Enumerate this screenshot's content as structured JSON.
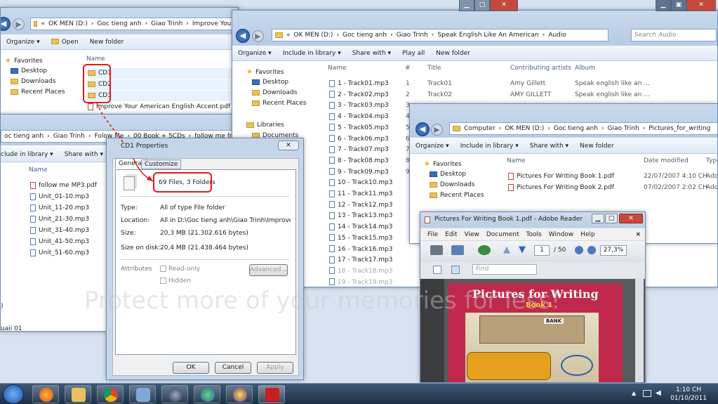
{
  "colors": {
    "annotation": "#e21b1b",
    "selection": "#cfe3fc"
  },
  "win1": {
    "address": [
      "«",
      "OK MEN (D:)",
      "›",
      "Goc tieng anh",
      "›",
      "Giao Trinh",
      "›",
      "Improve Your"
    ],
    "toolbar": {
      "organize": "Organize ▾",
      "open": "Open",
      "new_folder": "New folder"
    },
    "nav": [
      "Favorites",
      "Desktop",
      "Downloads",
      "Recent Places"
    ],
    "col_name": "Name",
    "items": [
      "CD1",
      "CD2",
      "CD3",
      "Improve Your American English Accent.pdf"
    ]
  },
  "win1b": {
    "address": [
      "oc tieng anh",
      "›",
      "Giao Trinh",
      "›",
      "Folow Me",
      "›",
      "00 Book + 5CDs",
      "›",
      "follow me from N"
    ],
    "toolbar": {
      "include": "clude in library ▾",
      "share": "Share with ▾"
    },
    "col_name": "Name",
    "items": [
      "follow me MP3.pdf",
      "Unit_01-10.mp3",
      "Unit_11-20.mp3",
      "Unit_21-30.mp3",
      "Unit_31-40.mp3",
      "Unit_41-50.mp3",
      "Unit_51-60.mp3"
    ],
    "side_text": [
      ")",
      "uaii 01"
    ]
  },
  "win2": {
    "address": [
      "«",
      "OK MEN (D:)",
      "›",
      "Goc tieng anh",
      "›",
      "Giao Trinh",
      "›",
      "Speak English Like An American",
      "›",
      "Audio"
    ],
    "search": "Search Audio",
    "toolbar": {
      "organize": "Organize ▾",
      "include": "Include in library ▾",
      "share": "Share with ▾",
      "play_all": "Play all",
      "new_folder": "New folder"
    },
    "nav": [
      "Favorites",
      "Desktop",
      "Downloads",
      "Recent Places",
      "Libraries",
      "Documents"
    ],
    "columns": {
      "name": "Name",
      "num": "#",
      "title": "Title",
      "artist": "Contributing artists",
      "album": "Album"
    },
    "tracks": [
      {
        "name": "1 - Track01.mp3",
        "num": "1",
        "title": "Track01",
        "artist": "Amy Gillett",
        "album": "Speak english like an ..."
      },
      {
        "name": "2 - Track02.mp3",
        "num": "2",
        "title": "Track02",
        "artist": "AMY GILLETT",
        "album": "Speak english like an ..."
      },
      {
        "name": "3 - Track03.mp3",
        "num": "3",
        "title": "",
        "artist": "",
        "album": ""
      },
      {
        "name": "4 - Track04.mp3",
        "num": "4",
        "title": "",
        "artist": "",
        "album": ""
      },
      {
        "name": "5 - Track05.mp3",
        "num": "5",
        "title": "",
        "artist": "",
        "album": ""
      },
      {
        "name": "6 - Track06.mp3",
        "num": "6",
        "title": "",
        "artist": "",
        "album": ""
      },
      {
        "name": "7 - Track07.mp3",
        "num": "7",
        "title": "",
        "artist": "",
        "album": ""
      },
      {
        "name": "8 - Track08.mp3",
        "num": "8",
        "title": "",
        "artist": "",
        "album": ""
      },
      {
        "name": "9 - Track09.mp3",
        "num": "9",
        "title": "",
        "artist": "",
        "album": ""
      },
      {
        "name": "10 - Track10.mp3",
        "num": "",
        "title": "",
        "artist": "",
        "album": ""
      },
      {
        "name": "11 - Track11.mp3",
        "num": "",
        "title": "",
        "artist": "",
        "album": ""
      },
      {
        "name": "12 - Track12.mp3",
        "num": "",
        "title": "",
        "artist": "",
        "album": ""
      },
      {
        "name": "13 - Track13.mp3",
        "num": "",
        "title": "",
        "artist": "",
        "album": ""
      },
      {
        "name": "14 - Track14.mp3",
        "num": "",
        "title": "",
        "artist": "",
        "album": ""
      },
      {
        "name": "15 - Track15.mp3",
        "num": "",
        "title": "",
        "artist": "",
        "album": ""
      },
      {
        "name": "16 - Track16.mp3",
        "num": "",
        "title": "",
        "artist": "",
        "album": ""
      },
      {
        "name": "17 - Track17.mp3",
        "num": "",
        "title": "",
        "artist": "",
        "album": ""
      },
      {
        "name": "18 - Track18.mp3",
        "num": "",
        "title": "",
        "artist": "",
        "album": ""
      },
      {
        "name": "19 - Track19.mp3",
        "num": "",
        "title": "",
        "artist": "",
        "album": ""
      }
    ]
  },
  "win3": {
    "address": [
      "Computer",
      "›",
      "OK MEN (D:)",
      "›",
      "Goc tieng anh",
      "›",
      "Giao Trinh",
      "›",
      "Pictures_for_writing"
    ],
    "toolbar": {
      "organize": "Organize ▾",
      "include": "Include in library ▾",
      "share": "Share with ▾",
      "new_folder": "New folder"
    },
    "nav": [
      "Favorites",
      "Desktop",
      "Downloads",
      "Recent Places"
    ],
    "columns": {
      "name": "Name",
      "date": "Date modified",
      "type": "Type"
    },
    "files": [
      {
        "name": "Pictures For Writing Book 1.pdf",
        "date": "22/07/2007 4:10 CH",
        "type": "Ado"
      },
      {
        "name": "Pictures For Writing Book 2.pdf",
        "date": "07/02/2007 2:02 CH",
        "type": "Ado"
      }
    ]
  },
  "props": {
    "title": "CD1 Properties",
    "tabs": [
      "General",
      "Customize"
    ],
    "summary": "69 Files, 3 Folders",
    "rows": [
      {
        "label": "Type:",
        "value": "All of type File folder"
      },
      {
        "label": "Location:",
        "value": "All in D:\\Goc tieng anh\\Giao Trinh\\Improve Your Am"
      },
      {
        "label": "Size:",
        "value": "20,3 MB (21.302.616 bytes)"
      },
      {
        "label": "Size on disk:",
        "value": "20,4 MB (21.438.464 bytes)"
      }
    ],
    "attributes_label": "Attributes",
    "readonly": "Read-only",
    "hidden": "Hidden",
    "advanced": "Advanced...",
    "ok": "OK",
    "cancel": "Cancel",
    "apply": "Apply"
  },
  "reader": {
    "title": "Pictures For Writing Book 1.pdf - Adobe Reader",
    "menu": [
      "File",
      "Edit",
      "View",
      "Document",
      "Tools",
      "Window",
      "Help"
    ],
    "page": "1",
    "page_total": "/ 50",
    "zoom": "27,3%",
    "find": "Find",
    "cover_title": "Pictures for Writing",
    "cover_sub": "Book 1",
    "cover_sign": "BANK"
  },
  "watermark": "Protect more of your memories for less!",
  "tray": {
    "time": "1:10 CH",
    "date": "01/10/2011"
  }
}
